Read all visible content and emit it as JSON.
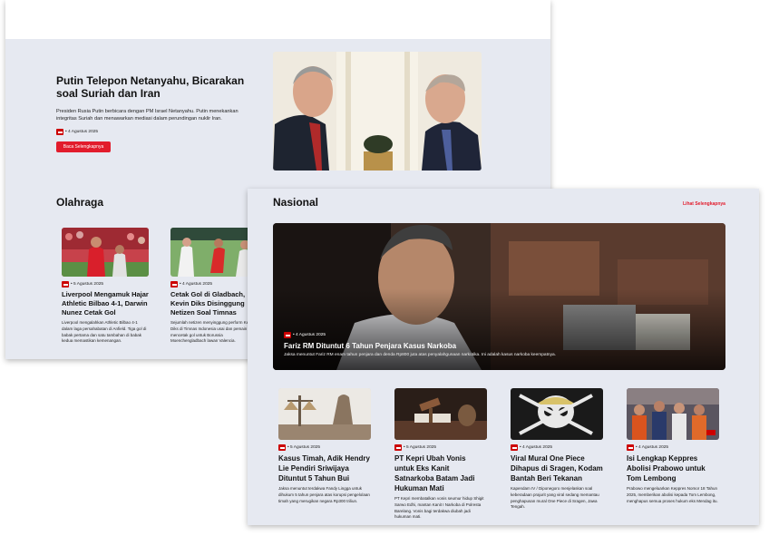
{
  "headline": {
    "title": "Putin Telepon Netanyahu, Bicarakan soal Suriah dan Iran",
    "description": "Presiden Rusia Putin berbicara dengan PM Israel Netanyahu. Putin menekankan integritas Suriah dan menawarkan mediasi dalam perundingan nuklir Iran.",
    "meta": "• 4 Agustus 2025",
    "button": "Baca Selengkapnya"
  },
  "olahraga": {
    "title": "Olahraga",
    "cards": [
      {
        "meta": "• 5 Agustus 2025",
        "title": "Liverpool Mengamuk Hajar Athletic Bilbao 4-1, Darwin Nunez Cetak Gol",
        "desc": "Liverpool mengalahkan Athletic Bilbao 4-1 dalam laga persahabatan di Anfield. Tiga gol di babak pertama dan satu tambahan di babak kedua memastikan kemenangan."
      },
      {
        "meta": "• 4 Agustus 2025",
        "title": "Cetak Gol di Gladbach, Kevin Diks Disinggung Netizen Soal Timnas",
        "desc": "Sejumlah netizen menyinggung perform Kevin Diks di Timnas Indonesia usai dan pemain mencetak gol untuk Borussia Moenchengladbach lawan Valencia."
      }
    ]
  },
  "nasional": {
    "title": "Nasional",
    "see_all": "Lihat Selengkapnya",
    "featured": {
      "meta": "• 4 Agustus 2025",
      "title": "Fariz RM Dituntut 6 Tahun Penjara Kasus Narkoba",
      "desc": "Jaksa menuntut Fariz RM enam tahun penjara dan denda Rp800 juta atas penyalahgunaan narkotika. Ini adalah kasus narkoba keempatnya."
    },
    "cards": [
      {
        "meta": "• 5 Agustus 2025",
        "title": "Kasus Timah, Adik Hendry Lie Pendiri Sriwijaya Dituntut 5 Tahun Bui",
        "desc": "Jaksa menuntut terdakwa Fandy Lingga untuk dihukum 5 tahun penjara atas korupsi pengelolaan timah yang merugikan negara Rp300 triliun."
      },
      {
        "meta": "• 5 Agustus 2025",
        "title": "PT Kepri Ubah Vonis untuk Eks Kanit Satnarkoba Batam Jadi Hukuman Mati",
        "desc": "PT Kepri membatalkan vonis seumur hidup Shigit Sarwo Edhi, mantan Kanit I Narkoba di Polresta Barelang. Vonis bagi terdakwa diubah jadi hukuman mati."
      },
      {
        "meta": "• 4 Agustus 2025",
        "title": "Viral Mural One Piece Dihapus di Sragen, Kodam Bantah Beri Tekanan",
        "desc": "Kapendam IV / Diponegoro menjelaskan soal keberadaan prajurit yang viral sedang memantau penghapusan mural One Piece di Sragen, Jawa Tengah."
      },
      {
        "meta": "• 4 Agustus 2025",
        "title": "Isi Lengkap Keppres Abolisi Prabowo untuk Tom Lembong",
        "desc": "Prabowo mengeluarkan Keppres Nomor 18 Tahun 2025, memberikan abolisi kepada Tom Lembong, menghapus semua proses hukum eks Mendag itu."
      }
    ]
  }
}
